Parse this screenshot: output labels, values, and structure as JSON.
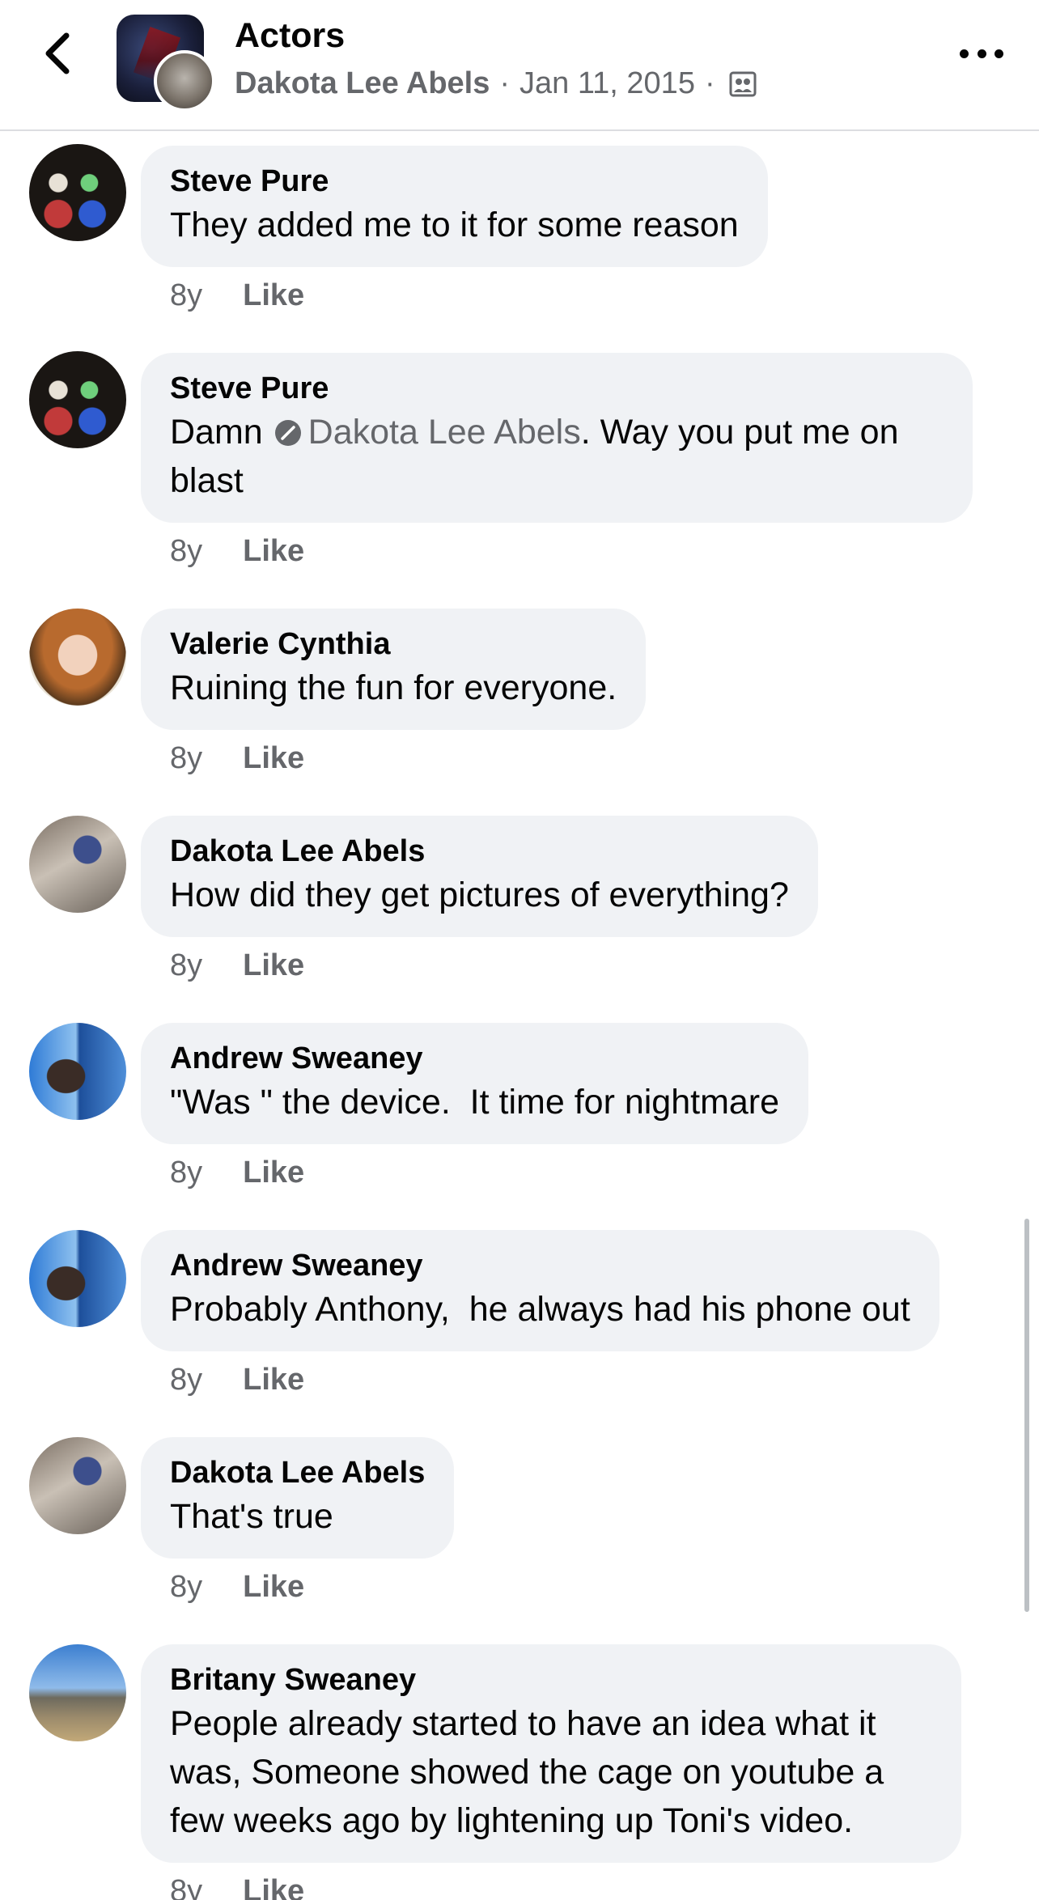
{
  "header": {
    "back_icon": "chevron-left-icon",
    "group_name": "Actors",
    "author": "Dakota Lee Abels",
    "separator": "·",
    "date": "Jan 11, 2015",
    "privacy_icon": "members-privacy-icon",
    "more_icon": "more-dots-icon"
  },
  "comments": [
    {
      "name": "Steve Pure",
      "text": "They added me to it for some reason",
      "time": "8y",
      "like": "Like"
    },
    {
      "name": "Steve Pure",
      "text_before": "Damn",
      "mention": "Dakota Lee Abels",
      "text_after": ". Way you put me on blast",
      "time": "8y",
      "like": "Like"
    },
    {
      "name": "Valerie Cynthia",
      "text": "Ruining the fun for everyone.",
      "time": "8y",
      "like": "Like"
    },
    {
      "name": "Dakota Lee Abels",
      "text": "How did they get pictures of everything?",
      "time": "8y",
      "like": "Like"
    },
    {
      "name": "Andrew Sweaney",
      "text": "\"Was \" the device.  It time for nightmare",
      "time": "8y",
      "like": "Like"
    },
    {
      "name": "Andrew Sweaney",
      "text": "Probably Anthony,  he always had his phone out",
      "time": "8y",
      "like": "Like"
    },
    {
      "name": "Dakota Lee Abels",
      "text": "That's true",
      "time": "8y",
      "like": "Like"
    },
    {
      "name": "Britany Sweaney",
      "text": "People already started to have an idea what it was, Someone showed the cage on youtube a few weeks ago by lightening up Toni's video.",
      "time": "8y",
      "like": "Like"
    }
  ],
  "colors": {
    "bubble": "#f0f2f5",
    "secondary_text": "#65676b",
    "primary_text": "#050505"
  }
}
